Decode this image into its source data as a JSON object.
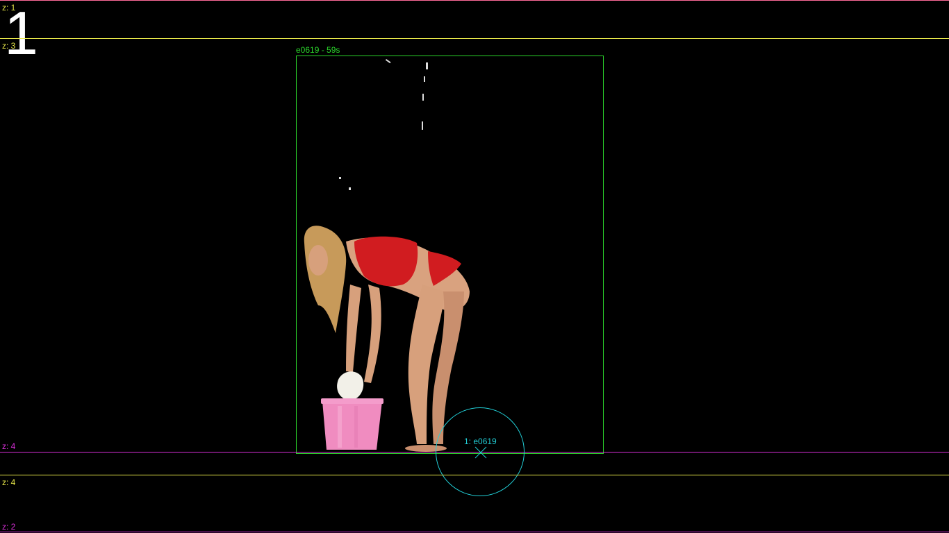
{
  "overlay": {
    "index_number": "1",
    "layers": [
      {
        "label": "z: 1",
        "color": "#ff6b9a"
      },
      {
        "label": "z: 3",
        "color": "#e9e94a"
      },
      {
        "label": "z: 4",
        "color": "#d92fd9"
      },
      {
        "label": "z: 4",
        "color": "#e9e94a"
      },
      {
        "label": "z: 2",
        "color": "#d92fd9"
      }
    ],
    "element_box": {
      "label": "e0619 - 59s",
      "color": "#2bd62b"
    },
    "anchor": {
      "label": "1: e0619",
      "color": "#22d0d8"
    }
  }
}
